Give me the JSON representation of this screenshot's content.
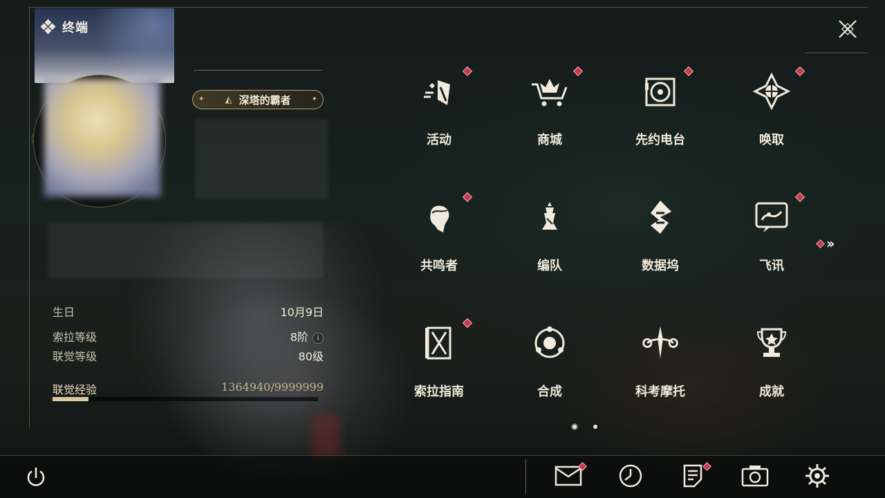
{
  "panel": {
    "title": "终端",
    "title_icon": "diamond-cluster-icon",
    "rank_title": "深塔的霸者"
  },
  "profile": {
    "birthday_label": "生日",
    "birthday_value": "10月9日",
    "sola_level_label": "索拉等级",
    "sola_level_value": "8阶",
    "union_level_label": "联觉等级",
    "union_level_value": "80级",
    "xp_label": "联觉经验",
    "xp_value": "1364940/9999999",
    "xp_progress": 0.136
  },
  "menu": [
    {
      "label": "活动",
      "icon": "event-icon",
      "badge": true
    },
    {
      "label": "商城",
      "icon": "shop-icon",
      "badge": true
    },
    {
      "label": "先约电台",
      "icon": "radio-icon",
      "badge": true
    },
    {
      "label": "唤取",
      "icon": "convene-icon",
      "badge": true
    },
    {
      "label": "共鸣者",
      "icon": "resonator-icon",
      "badge": true
    },
    {
      "label": "编队",
      "icon": "team-icon",
      "badge": false
    },
    {
      "label": "数据坞",
      "icon": "data-bank-icon",
      "badge": false
    },
    {
      "label": "飞讯",
      "icon": "message-icon",
      "badge": true
    },
    {
      "label": "索拉指南",
      "icon": "guidebook-icon",
      "badge": true
    },
    {
      "label": "合成",
      "icon": "synthesis-icon",
      "badge": false
    },
    {
      "label": "科考摩托",
      "icon": "motorcycle-icon",
      "badge": false
    },
    {
      "label": "成就",
      "icon": "trophy-icon",
      "badge": false
    }
  ],
  "pager": {
    "pages": 2,
    "current": 1
  },
  "bottom": [
    {
      "name": "mail-icon",
      "badge": true
    },
    {
      "name": "clock-icon",
      "badge": false
    },
    {
      "name": "notice-icon",
      "badge": true
    },
    {
      "name": "camera-icon",
      "badge": false
    },
    {
      "name": "settings-icon",
      "badge": false
    }
  ],
  "colors": {
    "accent_gold": "#d9c9a0",
    "badge_red": "#c8384b",
    "text": "#efe9d9"
  }
}
